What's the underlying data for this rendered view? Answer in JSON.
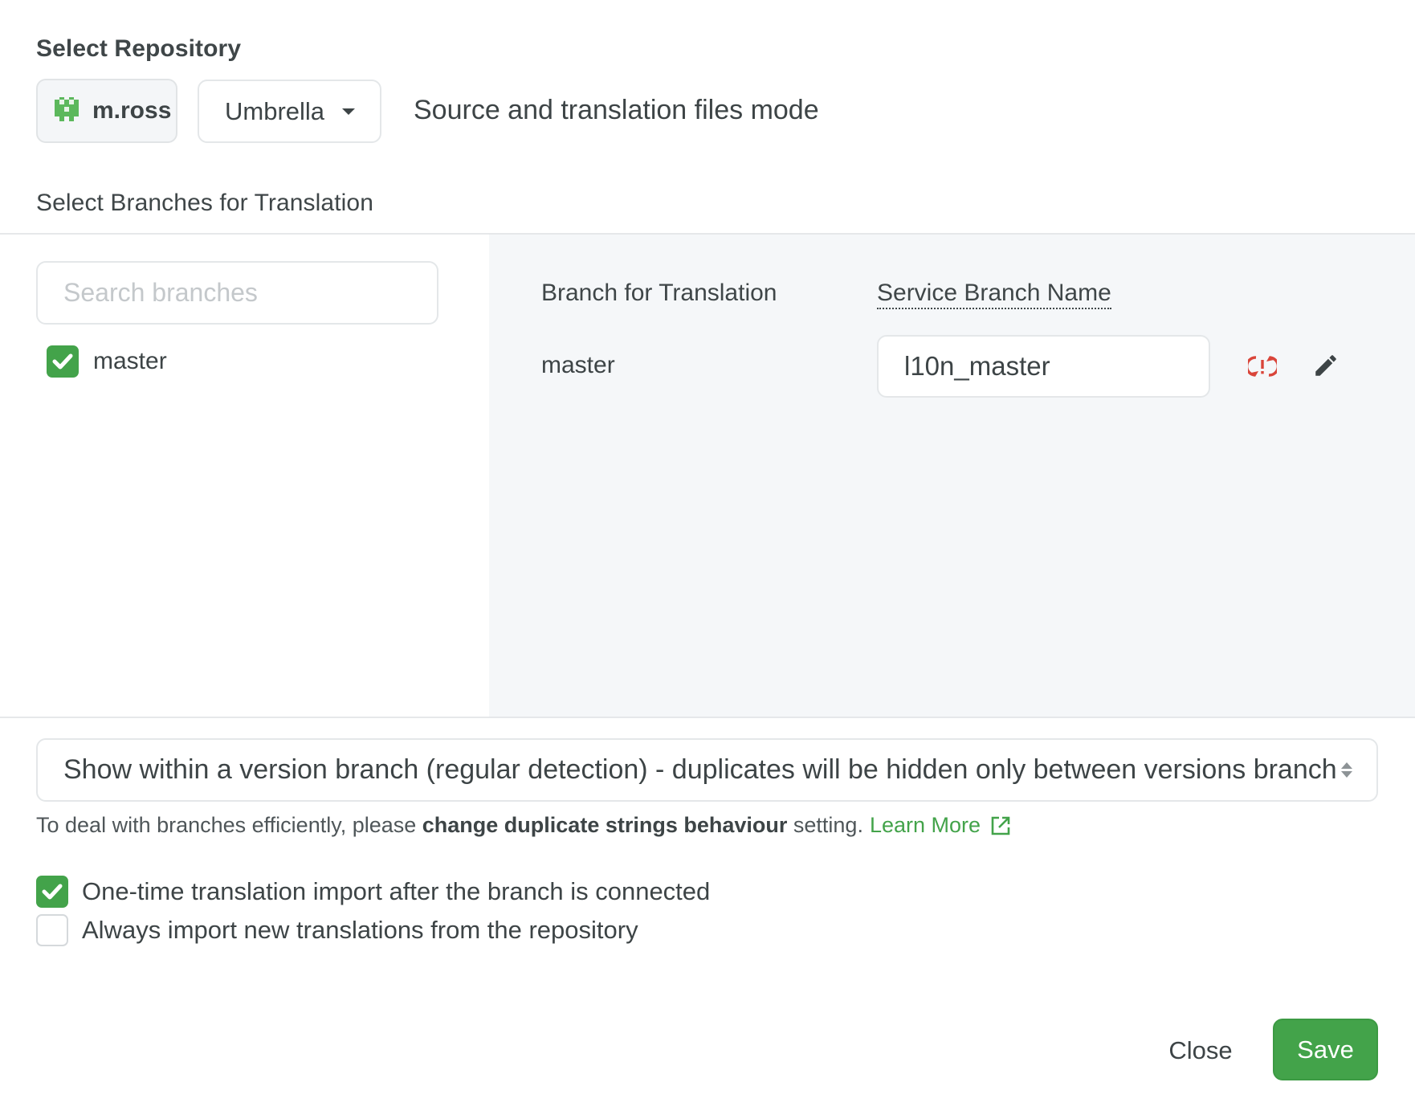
{
  "repository": {
    "section_title": "Select Repository",
    "account_label": "m.ross",
    "account_icon": "pixel-avatar-icon",
    "repo_selected": "Umbrella",
    "mode_text": "Source and translation files mode"
  },
  "branches": {
    "section_title": "Select Branches for Translation",
    "search": {
      "placeholder": "Search branches",
      "value": ""
    },
    "list": [
      {
        "label": "master",
        "checked": true
      }
    ],
    "table": {
      "headers": {
        "branch": "Branch for Translation",
        "service": "Service Branch Name"
      },
      "rows": [
        {
          "branch": "master",
          "service_branch": "l10n_master",
          "status_icon": "sync-warning-icon",
          "edit_icon": "pencil-icon"
        }
      ]
    }
  },
  "duplicates": {
    "selected": "Show within a version branch (regular detection) - duplicates will be hidden only between versions branch",
    "hint_prefix": "To deal with branches efficiently, please ",
    "hint_strong": "change duplicate strings behaviour",
    "hint_suffix": " setting.",
    "learn_more": "Learn More"
  },
  "options": [
    {
      "label": "One-time translation import after the branch is connected",
      "checked": true
    },
    {
      "label": "Always import new translations from the repository",
      "checked": false
    }
  ],
  "footer": {
    "close_label": "Close",
    "save_label": "Save"
  },
  "colors": {
    "accent": "#43a34a",
    "warning": "#d9453a",
    "text": "#3d4446",
    "panel_bg": "#f5f7f9"
  }
}
